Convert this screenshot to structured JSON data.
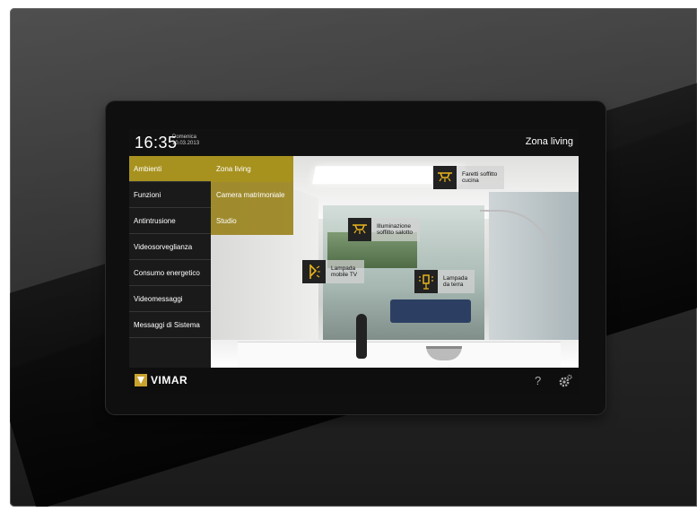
{
  "header": {
    "time": "16:35",
    "day": "Domenica",
    "date": "10.03.2013",
    "zone_title": "Zona living"
  },
  "sidebar": {
    "items": [
      {
        "label": "Ambienti",
        "active": true
      },
      {
        "label": "Funzioni"
      },
      {
        "label": "Antintrusione"
      },
      {
        "label": "Videosorveglianza"
      },
      {
        "label": "Consumo energetico"
      },
      {
        "label": "Videomessaggi"
      },
      {
        "label": "Messaggi di Sistema"
      }
    ]
  },
  "submenu": {
    "items": [
      {
        "label": "Zona living",
        "active": true
      },
      {
        "label": "Camera matrimoniale"
      },
      {
        "label": "Studio"
      }
    ]
  },
  "devices": [
    {
      "label": "Faretti soffitto\ncucina",
      "icon": "ceiling-spot-icon"
    },
    {
      "label": "Illuminazione\nsoffitto salotto",
      "icon": "ceiling-light-icon"
    },
    {
      "label": "Lampada\nmobile TV",
      "icon": "lamp-icon"
    },
    {
      "label": "Lampada\nda terra",
      "icon": "floor-lamp-icon"
    }
  ],
  "footer": {
    "brand": "VIMAR",
    "help": "?"
  },
  "colors": {
    "accent": "#a8921f",
    "device_icon": "#e8b41c"
  }
}
